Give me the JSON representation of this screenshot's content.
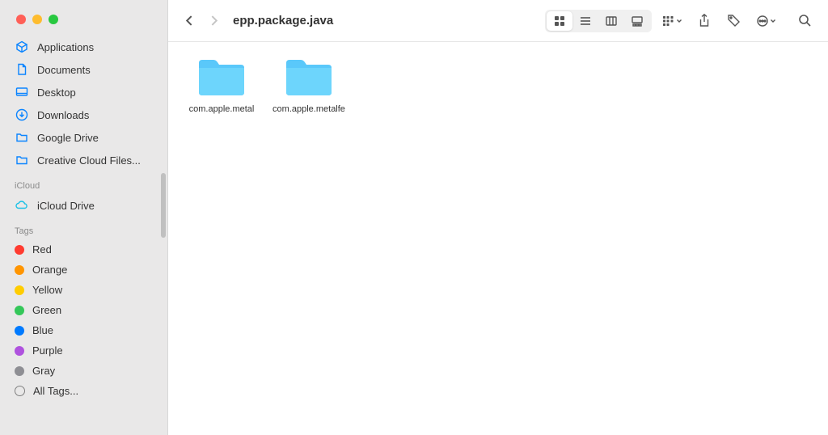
{
  "toolbar": {
    "title": "epp.package.java"
  },
  "sidebar": {
    "favorites": [
      {
        "label": "Applications",
        "icon": "applications"
      },
      {
        "label": "Documents",
        "icon": "document"
      },
      {
        "label": "Desktop",
        "icon": "desktop"
      },
      {
        "label": "Downloads",
        "icon": "downloads"
      },
      {
        "label": "Google Drive",
        "icon": "folder"
      },
      {
        "label": "Creative Cloud Files...",
        "icon": "folder"
      }
    ],
    "sections": {
      "icloud": "iCloud",
      "icloud_drive": "iCloud Drive",
      "tags": "Tags",
      "all_tags": "All Tags..."
    },
    "tags": [
      {
        "label": "Red",
        "color": "#ff3b30"
      },
      {
        "label": "Orange",
        "color": "#ff9500"
      },
      {
        "label": "Yellow",
        "color": "#ffcc00"
      },
      {
        "label": "Green",
        "color": "#34c759"
      },
      {
        "label": "Blue",
        "color": "#007aff"
      },
      {
        "label": "Purple",
        "color": "#af52de"
      },
      {
        "label": "Gray",
        "color": "#8e8e93"
      }
    ]
  },
  "folders": [
    {
      "name": "com.apple.metal"
    },
    {
      "name": "com.apple.metalfe"
    }
  ]
}
